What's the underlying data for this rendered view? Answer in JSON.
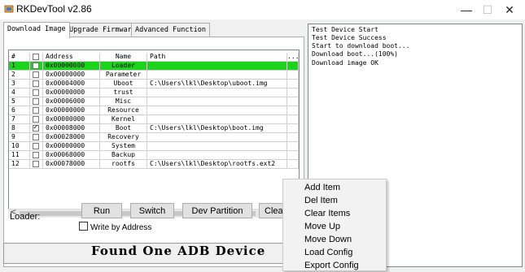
{
  "window": {
    "title": "RKDevTool v2.86",
    "minimize": "—",
    "maximize": "☐",
    "close": "✕"
  },
  "tabs": [
    "Download Image",
    "Upgrade Firmware",
    "Advanced Function"
  ],
  "grid": {
    "headers": [
      "#",
      "",
      "Address",
      "Name",
      "Path",
      "..."
    ],
    "rows": [
      {
        "num": "1",
        "checked": false,
        "address": "0x00000000",
        "name": "Loader",
        "path": "",
        "selected": true
      },
      {
        "num": "2",
        "checked": false,
        "address": "0x00000000",
        "name": "Parameter",
        "path": ""
      },
      {
        "num": "3",
        "checked": false,
        "address": "0x00004000",
        "name": "Uboot",
        "path": "C:\\Users\\lkl\\Desktop\\uboot.img"
      },
      {
        "num": "4",
        "checked": false,
        "address": "0x00000000",
        "name": "trust",
        "path": ""
      },
      {
        "num": "5",
        "checked": false,
        "address": "0x00006000",
        "name": "Misc",
        "path": ""
      },
      {
        "num": "6",
        "checked": false,
        "address": "0x00000000",
        "name": "Resource",
        "path": ""
      },
      {
        "num": "7",
        "checked": false,
        "address": "0x00000000",
        "name": "Kernel",
        "path": ""
      },
      {
        "num": "8",
        "checked": true,
        "address": "0x00008000",
        "name": "Boot",
        "path": "C:\\Users\\lkl\\Desktop\\boot.img"
      },
      {
        "num": "9",
        "checked": false,
        "address": "0x00028000",
        "name": "Recovery",
        "path": ""
      },
      {
        "num": "10",
        "checked": false,
        "address": "0x00000000",
        "name": "System",
        "path": ""
      },
      {
        "num": "11",
        "checked": false,
        "address": "0x00068000",
        "name": "Backup",
        "path": ""
      },
      {
        "num": "12",
        "checked": false,
        "address": "0x00078000",
        "name": "rootfs",
        "path": "C:\\Users\\lkl\\Desktop\\rootfs.ext2"
      }
    ]
  },
  "scroll_left": "<",
  "loader_label": "Loader:",
  "buttons": {
    "run": "Run",
    "switch": "Switch",
    "dev_partition": "Dev Partition",
    "clear": "Clear"
  },
  "write_by_address": "Write by Address",
  "status": "Found One ADB Device",
  "log": [
    "Test Device Start",
    "Test Device Success",
    "Start to download boot...",
    "Download boot...(100%)",
    "Download image OK"
  ],
  "context_menu": [
    "Add Item",
    "Del Item",
    "Clear Items",
    "Move Up",
    "Move Down",
    "Load Config",
    "Export Config"
  ],
  "colors": {
    "selected_row": "#1bd41b"
  }
}
